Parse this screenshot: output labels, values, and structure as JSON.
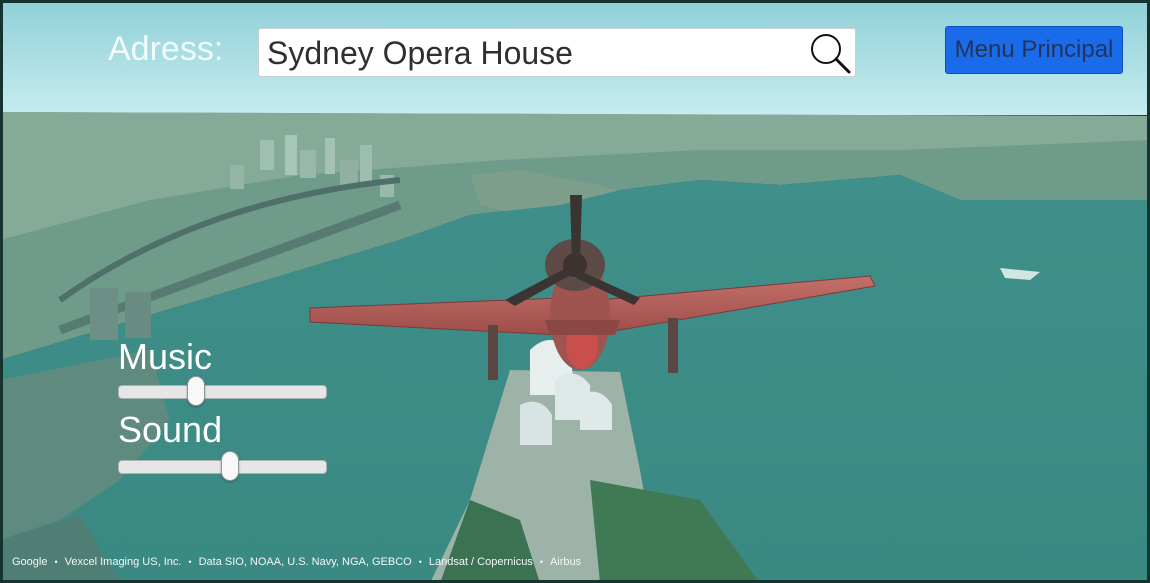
{
  "header": {
    "address_label": "Adress:",
    "address_value": "Sydney Opera House",
    "search_icon": "magnifier-icon",
    "menu_label": "Menu Principal"
  },
  "audio": {
    "music": {
      "label": "Music",
      "level": 0.36
    },
    "sound": {
      "label": "Sound",
      "level": 0.54
    }
  },
  "attribution": [
    "Google",
    "Vexcel Imaging US, Inc.",
    "Data SIO, NOAA, U.S. Navy, NGA, GEBCO",
    "Landsat / Copernicus",
    "Airbus"
  ],
  "colors": {
    "menu_button": "#1a6be9",
    "water_tint": "#3f8f8a",
    "airplane": "#b85a55"
  }
}
